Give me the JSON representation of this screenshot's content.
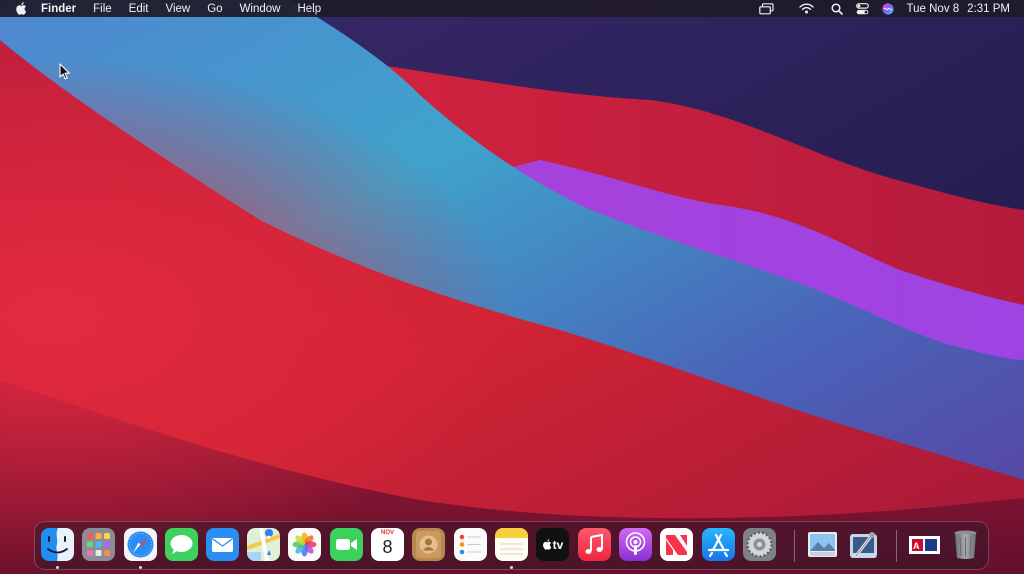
{
  "menubar": {
    "apple_icon": "apple-logo-icon",
    "menus": [
      "Finder",
      "File",
      "Edit",
      "View",
      "Go",
      "Window",
      "Help"
    ],
    "status_icons": [
      "screen-mirroring-icon",
      "wifi-icon",
      "spotlight-search-icon",
      "control-center-icon",
      "siri-icon"
    ],
    "clock": {
      "date": "Tue Nov 8",
      "time": "2:31 PM"
    }
  },
  "dock": {
    "apps": [
      {
        "name": "Finder",
        "icon": "finder-icon",
        "running": true
      },
      {
        "name": "Launchpad",
        "icon": "launchpad-icon",
        "running": false
      },
      {
        "name": "Safari",
        "icon": "safari-icon",
        "running": true
      },
      {
        "name": "Messages",
        "icon": "messages-icon",
        "running": false
      },
      {
        "name": "Mail",
        "icon": "mail-icon",
        "running": false
      },
      {
        "name": "Maps",
        "icon": "maps-icon",
        "running": false
      },
      {
        "name": "Photos",
        "icon": "photos-icon",
        "running": false
      },
      {
        "name": "FaceTime",
        "icon": "facetime-icon",
        "running": false
      },
      {
        "name": "Calendar",
        "icon": "calendar-icon",
        "running": false,
        "month": "NOV",
        "day": "8"
      },
      {
        "name": "Contacts",
        "icon": "contacts-icon",
        "running": false
      },
      {
        "name": "Reminders",
        "icon": "reminders-icon",
        "running": false
      },
      {
        "name": "Notes",
        "icon": "notes-icon",
        "running": true
      },
      {
        "name": "TV",
        "icon": "apple-tv-icon",
        "running": false,
        "label": "tv"
      },
      {
        "name": "Music",
        "icon": "music-icon",
        "running": false
      },
      {
        "name": "Podcasts",
        "icon": "podcasts-icon",
        "running": false
      },
      {
        "name": "News",
        "icon": "news-icon",
        "running": false
      },
      {
        "name": "App Store",
        "icon": "app-store-icon",
        "running": false
      },
      {
        "name": "System Preferences",
        "icon": "system-preferences-icon",
        "running": false
      }
    ],
    "extras": [
      {
        "name": "Preview",
        "icon": "preview-icon"
      },
      {
        "name": "Utility",
        "icon": "utility-icon"
      }
    ],
    "stack": {
      "name": "Downloads",
      "icon": "downloads-stack-icon"
    },
    "trash": {
      "name": "Trash",
      "icon": "trash-icon"
    }
  },
  "colors": {
    "menubar_bg": "#1e1a28",
    "wallpaper_blue": "#3fa2c9",
    "wallpaper_red": "#d1213d",
    "wallpaper_purple": "#9a3cdc"
  }
}
